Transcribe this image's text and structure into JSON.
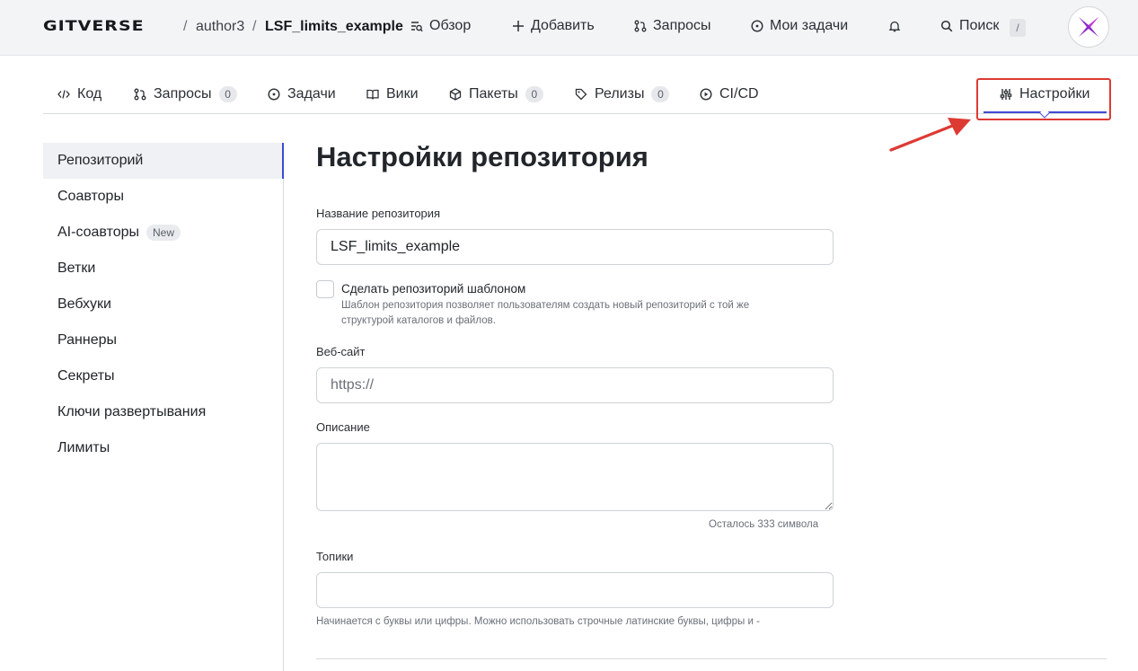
{
  "header": {
    "logo": "GITVERSE",
    "separator": "/",
    "owner": "author3",
    "repo": "LSF_limits_example",
    "nav": [
      {
        "label": "Обзор",
        "icon": "overview-icon"
      },
      {
        "label": "Добавить",
        "icon": "plus-icon"
      },
      {
        "label": "Запросы",
        "icon": "pull-request-icon"
      },
      {
        "label": "Мои задачи",
        "icon": "issue-icon"
      }
    ],
    "bell_icon": "bell-icon",
    "search_label": "Поиск",
    "search_shortcut": "/",
    "avatar_icon": "gitverse-avatar-icon"
  },
  "tabs": [
    {
      "label": "Код",
      "icon": "code-icon"
    },
    {
      "label": "Запросы",
      "count": "0",
      "icon": "pull-request-icon"
    },
    {
      "label": "Задачи",
      "icon": "issue-icon"
    },
    {
      "label": "Вики",
      "icon": "book-icon"
    },
    {
      "label": "Пакеты",
      "count": "0",
      "icon": "package-icon"
    },
    {
      "label": "Релизы",
      "count": "0",
      "icon": "tag-icon"
    },
    {
      "label": "CI/CD",
      "icon": "play-icon"
    },
    {
      "label": "Настройки",
      "icon": "sliders-icon",
      "active": true
    }
  ],
  "sidebar": {
    "items": [
      {
        "label": "Репозиторий",
        "active": true
      },
      {
        "label": "Соавторы"
      },
      {
        "label": "AI-соавторы",
        "badge": "New"
      },
      {
        "label": "Ветки"
      },
      {
        "label": "Вебхуки"
      },
      {
        "label": "Раннеры"
      },
      {
        "label": "Секреты"
      },
      {
        "label": "Ключи развертывания"
      },
      {
        "label": "Лимиты"
      }
    ]
  },
  "form": {
    "title": "Настройки репозитория",
    "name_label": "Название репозитория",
    "name_value": "LSF_limits_example",
    "template_label": "Сделать репозиторий шаблоном",
    "template_hint_1": "Шаблон репозитория позволяет пользователям создать новый репозиторий с той же",
    "template_hint_2": "структурой каталогов и файлов.",
    "website_label": "Веб-сайт",
    "website_placeholder": "https://",
    "description_label": "Описание",
    "description_value": "",
    "remaining": "Осталось 333 символа",
    "topics_label": "Топики",
    "topics_value": "",
    "topics_hint": "Начинается с буквы или цифры. Можно использовать строчные латинские буквы, цифры и -"
  },
  "colors": {
    "accent": "#3f4bd1",
    "annotation": "#dd3a33",
    "topbar_bg": "#f3f4f6"
  }
}
